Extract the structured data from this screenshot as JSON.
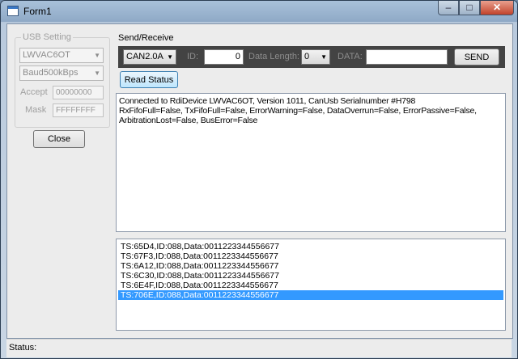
{
  "window": {
    "title": "Form1",
    "minimize": "–",
    "maximize": "□",
    "close": "✕"
  },
  "usb": {
    "group_label": "USB Setting",
    "device": "LWVAC6OT",
    "baud": "Baud500kBps",
    "accept_label": "Accept",
    "accept_value": "00000000",
    "mask_label": "Mask",
    "mask_value": "FFFFFFFF",
    "close_button": "Close"
  },
  "send": {
    "section_title": "Send/Receive",
    "protocol": "CAN2.0A",
    "id_label": "ID:",
    "id_value": "0",
    "length_label": "Data Length:",
    "length_value": "0",
    "data_label": "DATA:",
    "data_value": "",
    "send_button": "SEND",
    "read_status_button": "Read Status"
  },
  "status_text": [
    "Connected to RdiDevice LWVAC6OT, Version 1011, CanUsb Serialnumber #H798",
    "RxFifoFull=False, TxFifoFull=False, ErrorWarning=False, DataOverrun=False, ErrorPassive=False,",
    "ArbitrationLost=False, BusError=False"
  ],
  "messages": [
    "TS:65D4,ID:088,Data:0011223344556677",
    "TS:67F3,ID:088,Data:0011223344556677",
    "TS:6A12,ID:088,Data:0011223344556677",
    "TS:6C30,ID:088,Data:0011223344556677",
    "TS:6E4F,ID:088,Data:0011223344556677",
    "TS:706E,ID:088,Data:0011223344556677"
  ],
  "selected_message_index": 5,
  "statusbar": {
    "label": "Status:"
  },
  "icons": {
    "dropdown": "▼"
  },
  "colors": {
    "selection": "#3399ff",
    "toolbar": "#434343"
  }
}
